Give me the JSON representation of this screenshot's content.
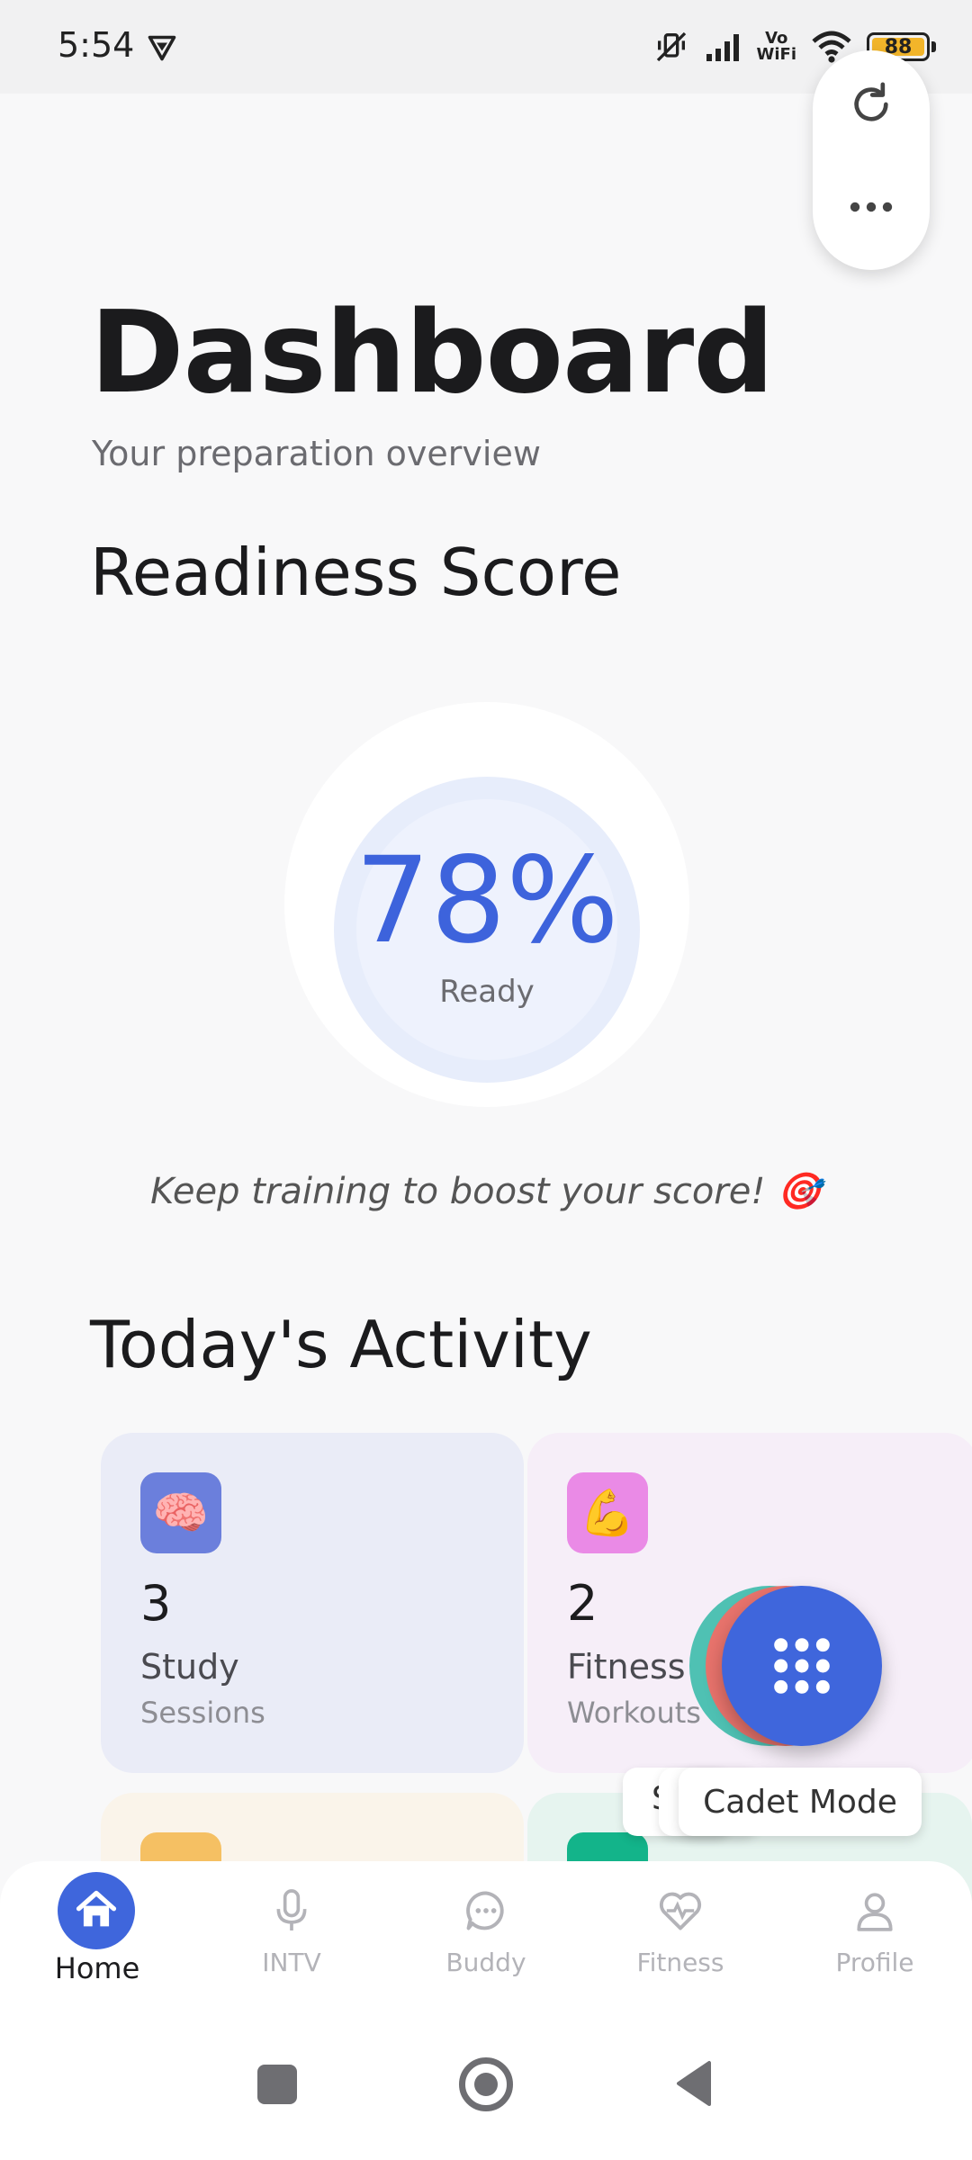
{
  "status_bar": {
    "time": "5:54",
    "battery": "88",
    "wifi_label_top": "Vo",
    "wifi_label_bottom": "WiFi"
  },
  "header": {
    "title": "Dashboard",
    "subtitle": "Your preparation overview"
  },
  "readiness": {
    "section_title": "Readiness Score",
    "value_text": "78%",
    "value": 78,
    "label": "Ready",
    "motivation": "Keep training to boost your score! 🎯"
  },
  "activity": {
    "section_title": "Today's Activity",
    "cards": [
      {
        "icon": "brain-icon",
        "emoji": "🧠",
        "count": "3",
        "label": "Study",
        "sub": "Sessions"
      },
      {
        "icon": "flexed-biceps-icon",
        "emoji": "💪",
        "count": "2",
        "label": "Fitness",
        "sub": "Workouts"
      }
    ]
  },
  "fab": {
    "chip_label": "Cadet Mode",
    "chip_peek": "S"
  },
  "nav": {
    "items": [
      {
        "label": "Home",
        "icon": "home-icon",
        "active": true
      },
      {
        "label": "INTV",
        "icon": "microphone-icon",
        "active": false
      },
      {
        "label": "Buddy",
        "icon": "chat-bubble-icon",
        "active": false
      },
      {
        "label": "Fitness",
        "icon": "heart-pulse-icon",
        "active": false
      },
      {
        "label": "Profile",
        "icon": "person-icon",
        "active": false
      }
    ]
  },
  "colors": {
    "accent": "#3f66dc",
    "background": "#f8f8f9"
  }
}
